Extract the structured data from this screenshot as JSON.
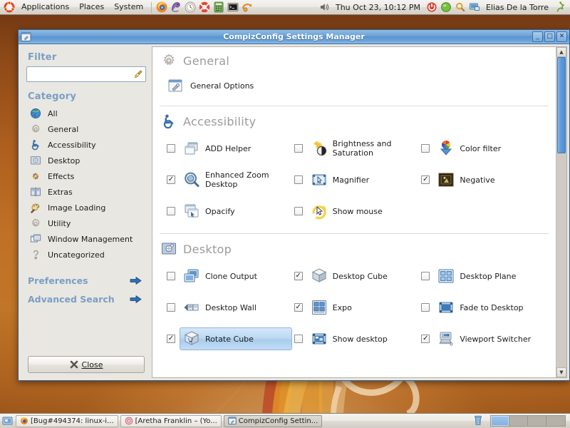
{
  "top_panel": {
    "menus": [
      "Applications",
      "Places",
      "System"
    ],
    "launchers": [
      "firefox-icon",
      "evolution-mail-icon",
      "help-icon",
      "lifering-help-icon",
      "calculator-icon",
      "terminal-icon",
      "update-manager-icon"
    ],
    "tray_icons": [
      "volume-icon",
      "shutdown-icon",
      "presence-online-icon",
      "search-icon",
      "display-icon"
    ],
    "clock": "Thu Oct 23, 10:12 PM",
    "user": "Elias De la Torre",
    "logout_icon": "logout-icon"
  },
  "window": {
    "title": "CompizConfig Settings Manager",
    "icon": "ccsm-icon",
    "buttons": {
      "minimize": "_",
      "maximize": "□",
      "close": "✕"
    }
  },
  "sidebar": {
    "filter_heading": "Filter",
    "filter_value": "",
    "filter_placeholder": "",
    "filter_clear_icon": "broom-clear-icon",
    "category_heading": "Category",
    "items": [
      {
        "label": "All",
        "icon": "globe-icon"
      },
      {
        "label": "General",
        "icon": "gear-icon"
      },
      {
        "label": "Accessibility",
        "icon": "accessibility-icon"
      },
      {
        "label": "Desktop",
        "icon": "desktop-icon"
      },
      {
        "label": "Effects",
        "icon": "effects-icon"
      },
      {
        "label": "Extras",
        "icon": "extras-icon"
      },
      {
        "label": "Image Loading",
        "icon": "image-loading-icon"
      },
      {
        "label": "Utility",
        "icon": "utility-gear-icon"
      },
      {
        "label": "Window Management",
        "icon": "window-management-icon"
      },
      {
        "label": "Uncategorized",
        "icon": "question-mark-icon"
      }
    ],
    "preferences_label": "Preferences",
    "advanced_search_label": "Advanced Search",
    "arrow_icon": "arrow-right-icon",
    "close_label": "Close",
    "close_icon": "close-x-icon"
  },
  "sections": [
    {
      "title": "General",
      "icon": "gear-icon",
      "layout": "single",
      "plugins": [
        {
          "label": "General Options",
          "icon": "general-options-icon",
          "checked": null,
          "selected": false
        }
      ]
    },
    {
      "title": "Accessibility",
      "icon": "accessibility-icon",
      "layout": "grid",
      "plugins": [
        {
          "label": "ADD Helper",
          "icon": "add-helper-icon",
          "checked": false,
          "selected": false
        },
        {
          "label": "Brightness and Saturation",
          "icon": "brightness-saturation-icon",
          "checked": false,
          "selected": false
        },
        {
          "label": "Color filter",
          "icon": "color-filter-icon",
          "checked": false,
          "selected": false
        },
        {
          "label": "Enhanced Zoom Desktop",
          "icon": "enhanced-zoom-icon",
          "checked": true,
          "selected": false
        },
        {
          "label": "Magnifier",
          "icon": "magnifier-icon",
          "checked": false,
          "selected": false
        },
        {
          "label": "Negative",
          "icon": "negative-icon",
          "checked": true,
          "selected": false
        },
        {
          "label": "Opacify",
          "icon": "opacify-icon",
          "checked": false,
          "selected": false
        },
        {
          "label": "Show mouse",
          "icon": "show-mouse-icon",
          "checked": false,
          "selected": false
        }
      ]
    },
    {
      "title": "Desktop",
      "icon": "desktop-icon",
      "layout": "grid",
      "plugins": [
        {
          "label": "Clone Output",
          "icon": "clone-output-icon",
          "checked": false,
          "selected": false
        },
        {
          "label": "Desktop Cube",
          "icon": "desktop-cube-icon",
          "checked": true,
          "selected": false
        },
        {
          "label": "Desktop Plane",
          "icon": "desktop-plane-icon",
          "checked": false,
          "selected": false
        },
        {
          "label": "Desktop Wall",
          "icon": "desktop-wall-icon",
          "checked": false,
          "selected": false
        },
        {
          "label": "Expo",
          "icon": "expo-icon",
          "checked": true,
          "selected": false
        },
        {
          "label": "Fade to Desktop",
          "icon": "fade-to-desktop-icon",
          "checked": false,
          "selected": false
        },
        {
          "label": "Rotate Cube",
          "icon": "rotate-cube-icon",
          "checked": true,
          "selected": true
        },
        {
          "label": "Show desktop",
          "icon": "show-desktop-icon",
          "checked": false,
          "selected": false
        },
        {
          "label": "Viewport Switcher",
          "icon": "viewport-switcher-icon",
          "checked": true,
          "selected": false
        }
      ]
    }
  ],
  "scrollbar": {
    "up_arrow": "▲",
    "down_arrow": "▼",
    "thumb_position_percent": 0
  },
  "bottom_panel": {
    "show_desktop_icon": "show-desktop-icon",
    "tasks": [
      {
        "label": "[Bug#494374: linux-i...",
        "icon": "firefox-icon",
        "active": false
      },
      {
        "label": "[Aretha Franklin – (Yo...",
        "icon": "rhythmbox-icon",
        "active": false
      },
      {
        "label": "CompizConfig Settin...",
        "icon": "ccsm-icon",
        "active": true
      }
    ],
    "trash_icon": "trash-icon",
    "workspaces": 4,
    "active_workspace": 1
  },
  "colors": {
    "titlebar_blue": "#5b94cf",
    "heading_blue": "#7a9ec4",
    "selection_blue": "#a8cdee",
    "desktop_orange": "#c07527",
    "panel_gray": "#e9e7e2"
  }
}
